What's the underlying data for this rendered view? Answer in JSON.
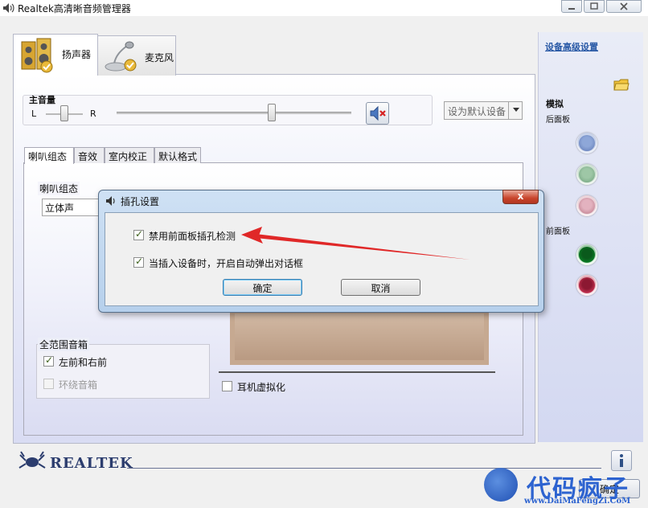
{
  "window": {
    "title": "Realtek高清晰音频管理器"
  },
  "device_tabs": [
    {
      "label": "扬声器",
      "icon": "speaker-icon",
      "active": true
    },
    {
      "label": "麦克风",
      "icon": "microphone-icon",
      "active": false
    }
  ],
  "volume": {
    "label": "主音量",
    "balance_left": "L",
    "balance_right": "R",
    "level": 0.66,
    "balance": 0.5,
    "muted": true,
    "mute_icon": "speaker-muted-icon"
  },
  "default_device": {
    "label": "设为默认设备"
  },
  "sub_tabs": [
    {
      "label": "喇叭组态",
      "active": true
    },
    {
      "label": "音效",
      "active": false
    },
    {
      "label": "室内校正",
      "active": false
    },
    {
      "label": "默认格式",
      "active": false
    }
  ],
  "speaker_config": {
    "group_label": "喇叭组态",
    "selected": "立体声"
  },
  "full_range": {
    "group_label": "全范围音箱",
    "front": {
      "label": "左前和右前",
      "checked": true
    },
    "surround": {
      "label": "环绕音箱",
      "checked": false,
      "enabled": false
    }
  },
  "headphone_virtualization": {
    "label": "耳机虚拟化",
    "checked": false
  },
  "right_panel": {
    "advanced_link": "设备高级设置",
    "analog_label": "模拟",
    "back_panel_label": "后面板",
    "front_panel_label": "前面板",
    "back_jacks": [
      {
        "name": "blue",
        "color": "#7a93cc"
      },
      {
        "name": "green",
        "color": "#8dba97"
      },
      {
        "name": "pink",
        "color": "#d49ead"
      }
    ],
    "front_jacks": [
      {
        "name": "green",
        "color": "#0c7a26"
      },
      {
        "name": "pink",
        "color": "#b8304b"
      }
    ]
  },
  "brand": {
    "name": "REALTEK"
  },
  "main_ok": {
    "label": "确定"
  },
  "dialog": {
    "title": "插孔设置",
    "options": [
      {
        "label": "禁用前面板插孔检测",
        "checked": true
      },
      {
        "label": "当插入设备时，开启自动弹出对话框",
        "checked": true
      }
    ],
    "ok_label": "确定",
    "cancel_label": "取消",
    "close_label": "x"
  },
  "watermark": {
    "text": "代码疯子",
    "url": "www.DaiMaFengZi.CoM"
  },
  "colors": {
    "accent_link": "#2a5aa6",
    "arrow": "#e02828",
    "watermark": "#2d63d0"
  }
}
